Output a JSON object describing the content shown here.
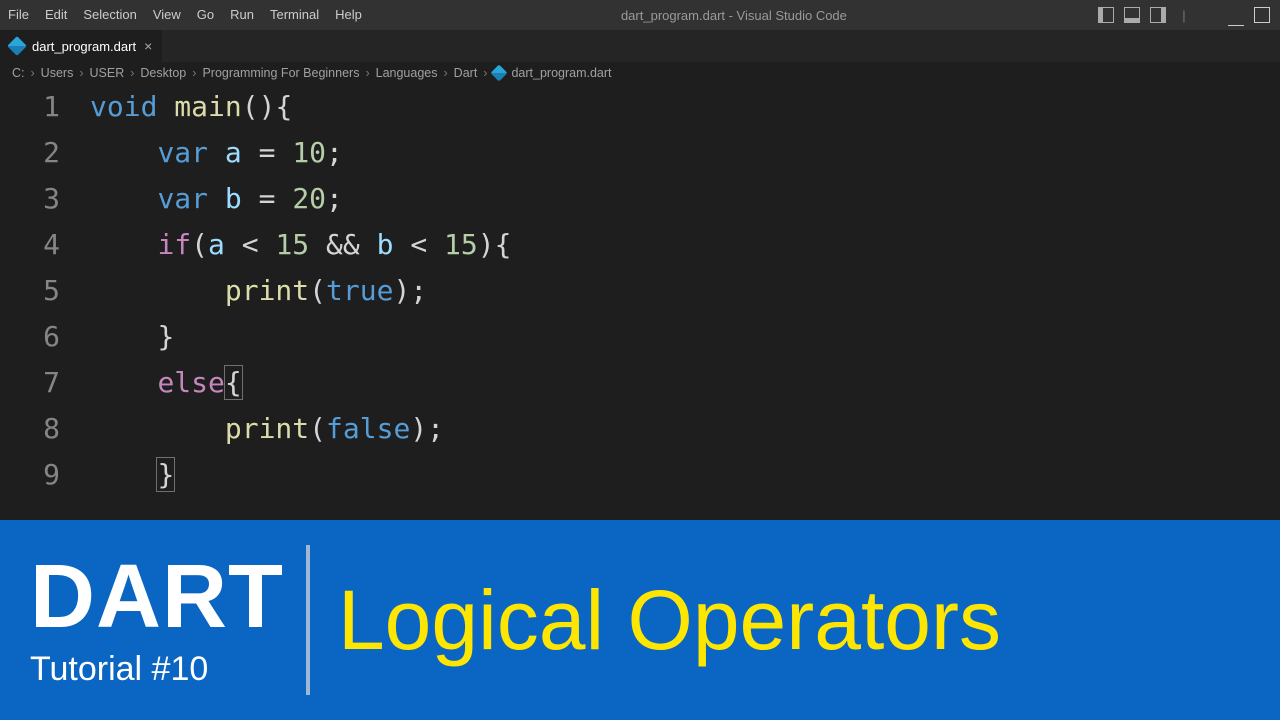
{
  "menubar": {
    "items": [
      "File",
      "Edit",
      "Selection",
      "View",
      "Go",
      "Run",
      "Terminal",
      "Help"
    ],
    "title": "dart_program.dart - Visual Studio Code"
  },
  "tab": {
    "filename": "dart_program.dart"
  },
  "breadcrumb": {
    "parts": [
      "C:",
      "Users",
      "USER",
      "Desktop",
      "Programming For Beginners",
      "Languages",
      "Dart",
      "dart_program.dart"
    ]
  },
  "code": {
    "lines": [
      {
        "n": "1",
        "tokens": [
          [
            "kw",
            "void"
          ],
          [
            "punct",
            " "
          ],
          [
            "func",
            "main"
          ],
          [
            "punct",
            "()"
          ],
          [
            "punct",
            "{"
          ]
        ]
      },
      {
        "n": "2",
        "indent": 1,
        "tokens": [
          [
            "kw",
            "var"
          ],
          [
            "punct",
            " "
          ],
          [
            "ident",
            "a"
          ],
          [
            "punct",
            " "
          ],
          [
            "op",
            "="
          ],
          [
            "punct",
            " "
          ],
          [
            "num",
            "10"
          ],
          [
            "punct",
            ";"
          ]
        ]
      },
      {
        "n": "3",
        "indent": 1,
        "tokens": [
          [
            "kw",
            "var"
          ],
          [
            "punct",
            " "
          ],
          [
            "ident",
            "b"
          ],
          [
            "punct",
            " "
          ],
          [
            "op",
            "="
          ],
          [
            "punct",
            " "
          ],
          [
            "num",
            "20"
          ],
          [
            "punct",
            ";"
          ]
        ]
      },
      {
        "n": "4",
        "indent": 1,
        "tokens": [
          [
            "kw2",
            "if"
          ],
          [
            "punct",
            "("
          ],
          [
            "ident",
            "a"
          ],
          [
            "punct",
            " "
          ],
          [
            "op",
            "<"
          ],
          [
            "punct",
            " "
          ],
          [
            "num",
            "15"
          ],
          [
            "punct",
            " "
          ],
          [
            "op",
            "&&"
          ],
          [
            "punct",
            " "
          ],
          [
            "ident",
            "b"
          ],
          [
            "punct",
            " "
          ],
          [
            "op",
            "<"
          ],
          [
            "punct",
            " "
          ],
          [
            "num",
            "15"
          ],
          [
            "punct",
            "){"
          ]
        ]
      },
      {
        "n": "5",
        "indent": 2,
        "tokens": [
          [
            "func",
            "print"
          ],
          [
            "punct",
            "("
          ],
          [
            "bool",
            "true"
          ],
          [
            "punct",
            ");"
          ]
        ]
      },
      {
        "n": "6",
        "indent": 1,
        "tokens": [
          [
            "punct",
            "}"
          ]
        ]
      },
      {
        "n": "7",
        "indent": 1,
        "tokens": [
          [
            "kw2",
            "else"
          ],
          [
            "punct hl",
            "{"
          ]
        ]
      },
      {
        "n": "8",
        "indent": 2,
        "tokens": [
          [
            "func",
            "print"
          ],
          [
            "punct",
            "("
          ],
          [
            "bool",
            "false"
          ],
          [
            "punct",
            ");"
          ]
        ]
      },
      {
        "n": "9",
        "indent": 1,
        "tokens": [
          [
            "punct hl",
            "}"
          ]
        ]
      }
    ]
  },
  "banner": {
    "title": "DART",
    "subtitle": "Tutorial #10",
    "topic": "Logical Operators"
  }
}
